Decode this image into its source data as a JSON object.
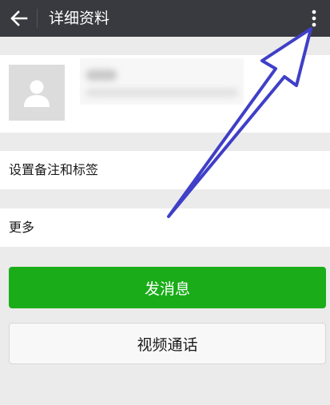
{
  "header": {
    "title": "详细资料",
    "back_icon": "arrow-left-icon",
    "more_icon": "more-vertical-icon"
  },
  "profile": {
    "avatar_icon": "user-silhouette-icon"
  },
  "rows": {
    "remark_tags": "设置备注和标签",
    "more": "更多"
  },
  "actions": {
    "send_message": "发消息",
    "video_call": "视频通话"
  },
  "colors": {
    "topbar": "#393a3f",
    "primary_button": "#1aad19",
    "annotation_arrow": "#3f3fc8",
    "background": "#ebebeb"
  }
}
